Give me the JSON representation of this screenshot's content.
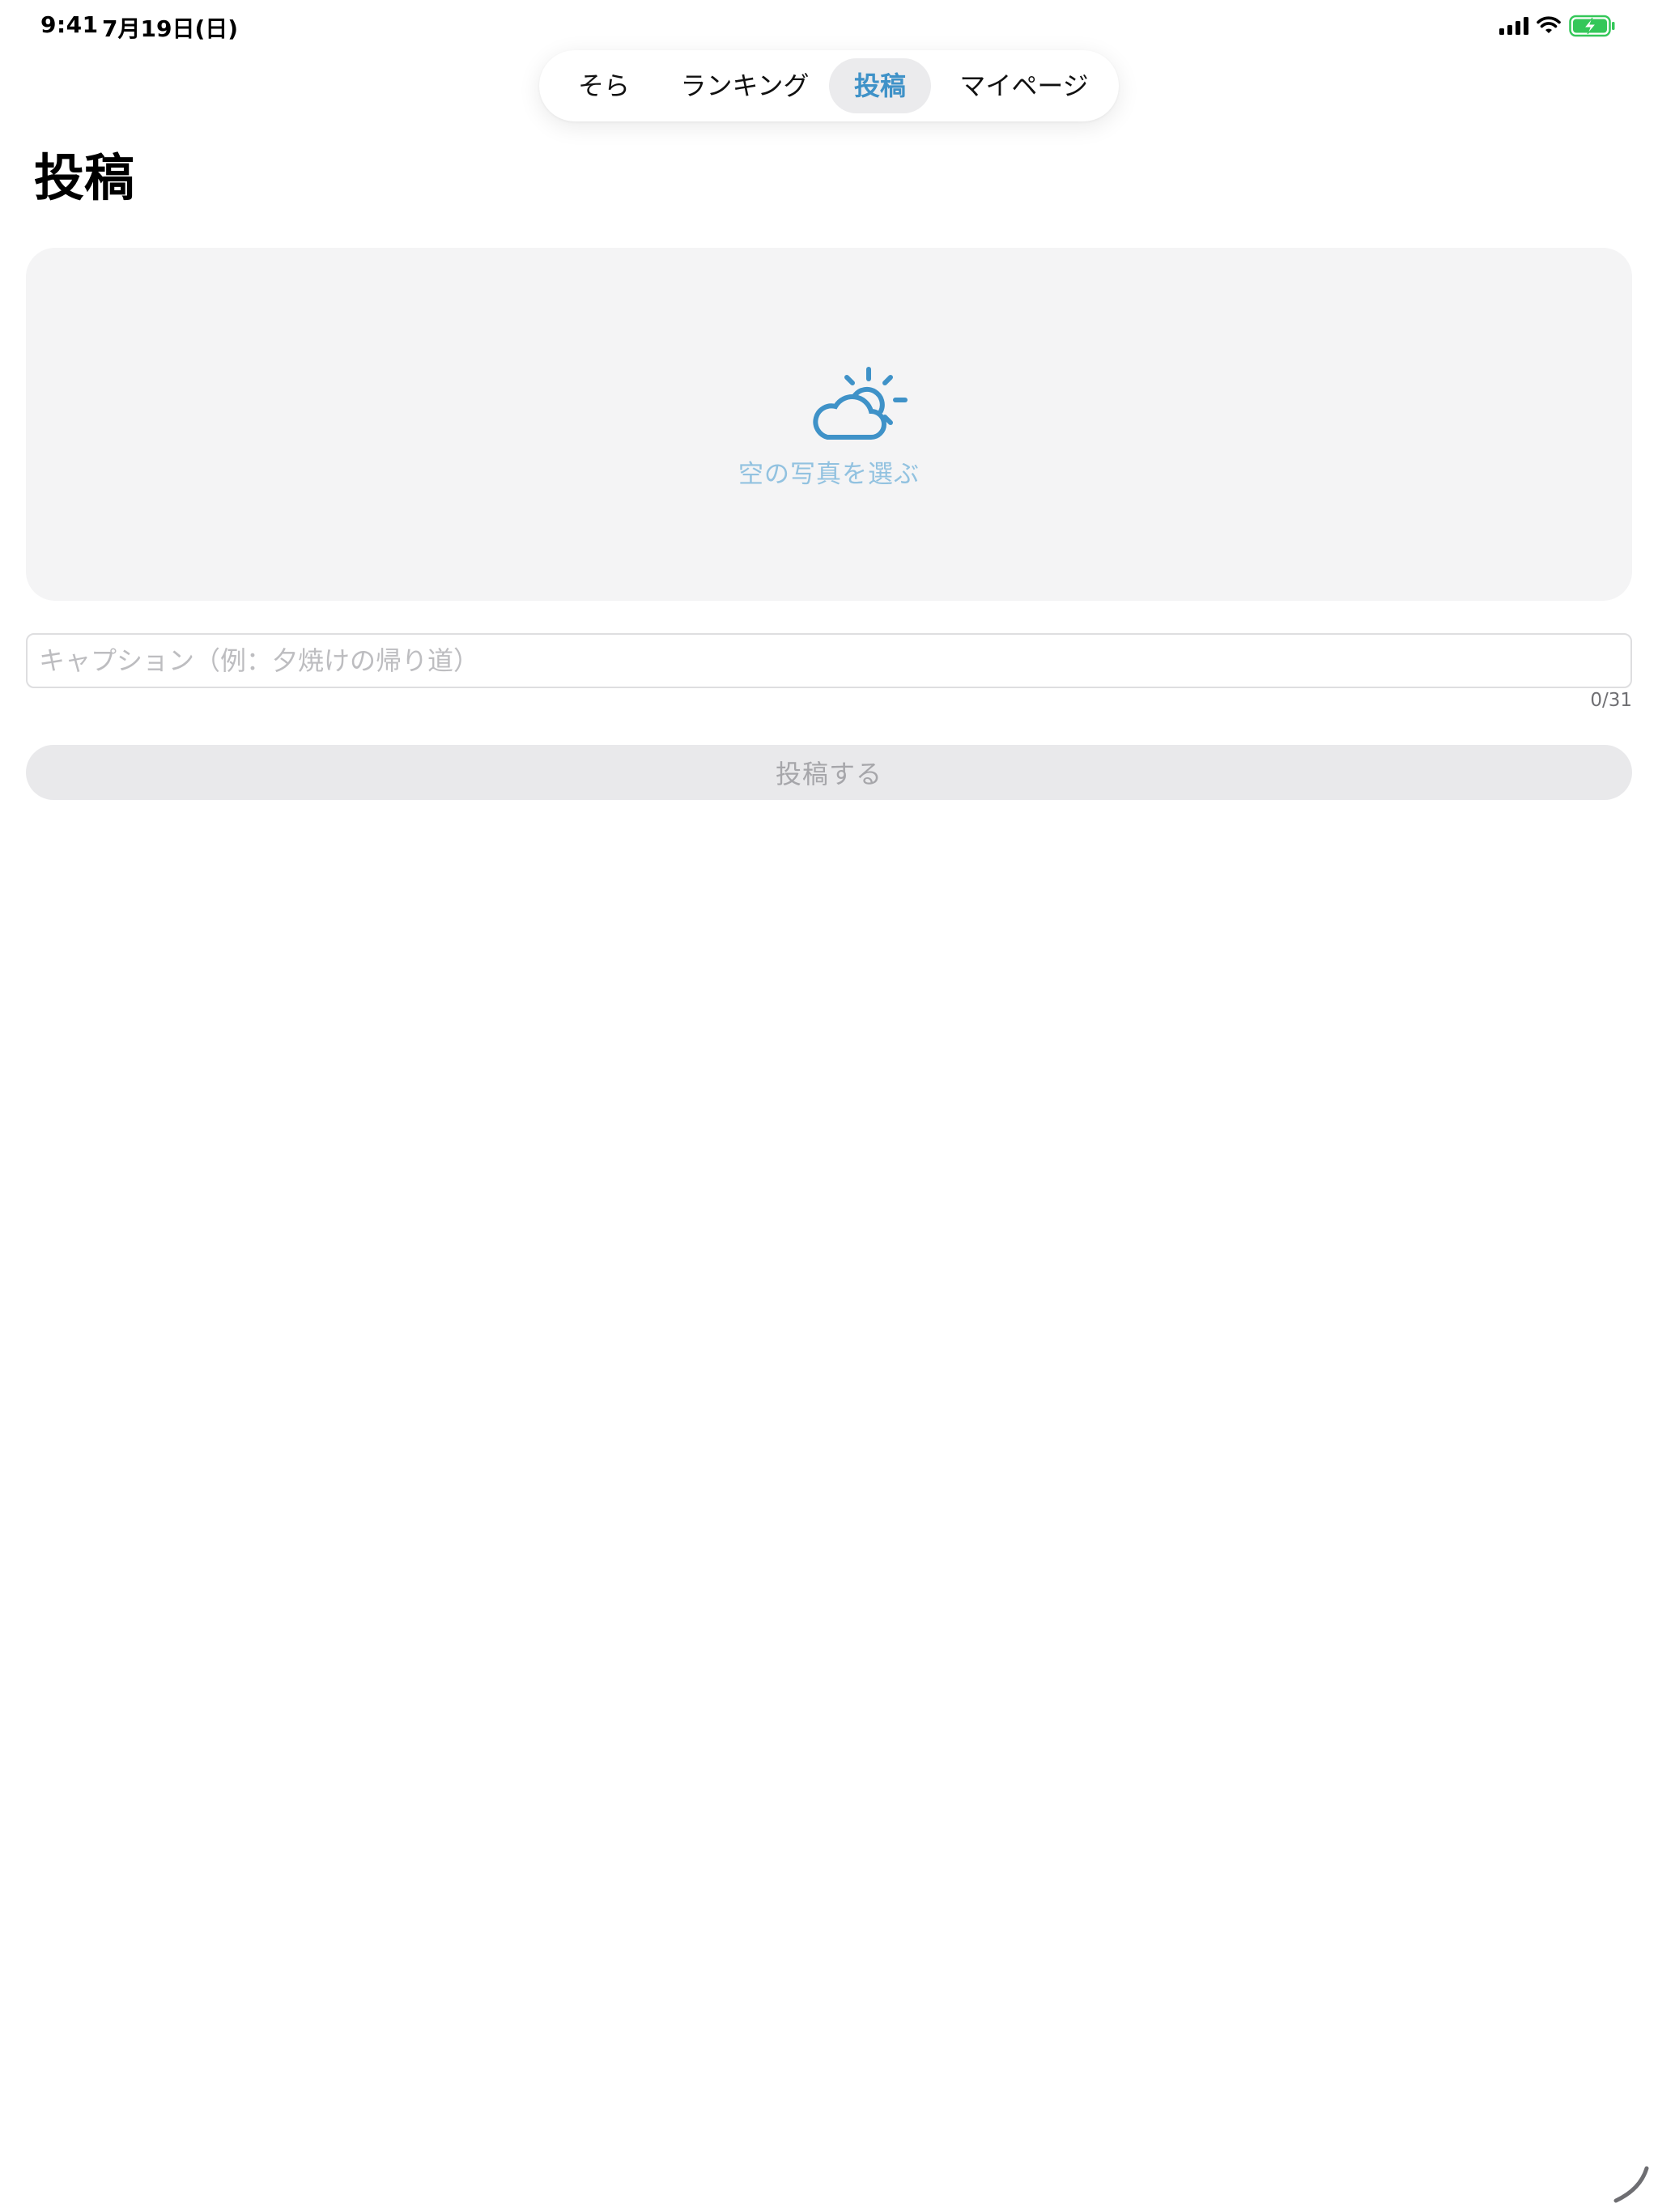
{
  "status_bar": {
    "time": "9:41",
    "date": "7月19日(日)",
    "icons": [
      "cellular-signal-icon",
      "wifi-icon",
      "battery-charging-icon"
    ],
    "battery_color": "#34c759"
  },
  "tabs": [
    {
      "label": "そら",
      "active": false
    },
    {
      "label": "ランキング",
      "active": false
    },
    {
      "label": "投稿",
      "active": true
    },
    {
      "label": "マイページ",
      "active": false
    }
  ],
  "page": {
    "title": "投稿"
  },
  "photo_picker": {
    "icon": "cloud-sun-icon",
    "label": "空の写真を選ぶ"
  },
  "caption": {
    "value": "",
    "placeholder": "キャプション（例：夕焼けの帰り道）",
    "counter": "0/31"
  },
  "submit": {
    "label": "投稿する",
    "disabled": true
  },
  "colors": {
    "accent": "#3f92c8",
    "accent_light": "#92c2e0",
    "surface": "#f4f4f5",
    "disabled_bg": "#e9e9eb",
    "disabled_text": "#a6a6aa"
  }
}
